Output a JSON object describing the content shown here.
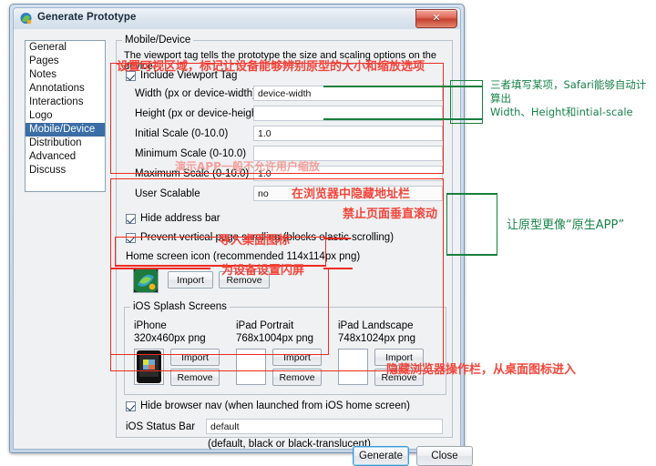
{
  "window": {
    "title": "Generate Prototype",
    "icon": "axure-logo-icon",
    "close_label": "✕"
  },
  "sidebar": {
    "items": [
      {
        "label": "General",
        "selected": false
      },
      {
        "label": "Pages",
        "selected": false
      },
      {
        "label": "Notes",
        "selected": false
      },
      {
        "label": "Annotations",
        "selected": false
      },
      {
        "label": "Interactions",
        "selected": false
      },
      {
        "label": "Logo",
        "selected": false
      },
      {
        "label": "Mobile/Device",
        "selected": true
      },
      {
        "label": "Distribution",
        "selected": false
      },
      {
        "label": "Advanced",
        "selected": false
      },
      {
        "label": "Discuss",
        "selected": false
      }
    ]
  },
  "group": {
    "title": "Mobile/Device",
    "description": "The viewport tag tells the prototype the size and scaling options on the device.",
    "include_viewport": {
      "label": "Include Viewport Tag",
      "checked": true
    },
    "fields": [
      {
        "label": "Width (px or device-width)",
        "value": "device-width"
      },
      {
        "label": "Height (px or device-height)",
        "value": ""
      },
      {
        "label": "Initial Scale (0-10.0)",
        "value": "1.0"
      },
      {
        "label": "Minimum Scale (0-10.0)",
        "value": ""
      },
      {
        "label": "Maximum Scale (0-10.0)",
        "value": "1.0"
      },
      {
        "label": "User Scalable",
        "value": "no"
      }
    ],
    "hide_address_bar": {
      "label": "Hide address bar",
      "checked": true
    },
    "prevent_scroll": {
      "label": "Prevent vertical page scrolling (blocks elastic scrolling)",
      "checked": true
    },
    "home_icon_label": "Home screen icon (recommended 114x114px png)",
    "home_icon_import": "Import",
    "home_icon_remove": "Remove",
    "home_icon_thumb": "axure-app-icon",
    "splash": {
      "title": "iOS Splash Screens",
      "items": [
        {
          "device": "iPhone",
          "size": "320x460px png",
          "import": "Import",
          "remove": "Remove",
          "thumb": "iphone-splash-thumb",
          "has_image": true
        },
        {
          "device": "iPad Portrait",
          "size": "768x1004px png",
          "import": "Import",
          "remove": "Remove",
          "thumb": "ipad-portrait-splash-thumb",
          "has_image": false
        },
        {
          "device": "iPad Landscape",
          "size": "748x1024px png",
          "import": "Import",
          "remove": "Remove",
          "thumb": "ipad-landscape-splash-thumb",
          "has_image": false
        }
      ]
    },
    "hide_browser_nav": {
      "label": "Hide browser nav (when launched from iOS home screen)",
      "checked": true
    },
    "status_bar_label": "iOS Status Bar",
    "status_bar_value": "default",
    "status_bar_hint": "(default, black or black-translucent)"
  },
  "buttons": {
    "generate": "Generate",
    "close": "Close"
  },
  "annotations": {
    "viewport_note": "设置可视区域，标记让设备能够辨别原型的大小和缩放选项",
    "user_scalable_note": "演示APP一般不允许用户缩放",
    "hide_address_note": "在浏览器中隐藏地址栏",
    "prevent_scroll_note": "禁止页面垂直滚动",
    "home_icon_note": "导入桌面图标",
    "splash_note": "为设备设置闪屏",
    "browser_nav_note": "隐藏浏览器操作栏，从桌面图标进入",
    "safari_note_line1": "三者填写某项，Safari能够自动计算出",
    "safari_note_line2": "Width、Height和intial-scale",
    "native_app_note": "让原型更像“原生APP”",
    "colors": {
      "red": "#ee2b22",
      "red_text": "#f2463c",
      "green": "#17803c",
      "green_text": "#18824a"
    }
  }
}
